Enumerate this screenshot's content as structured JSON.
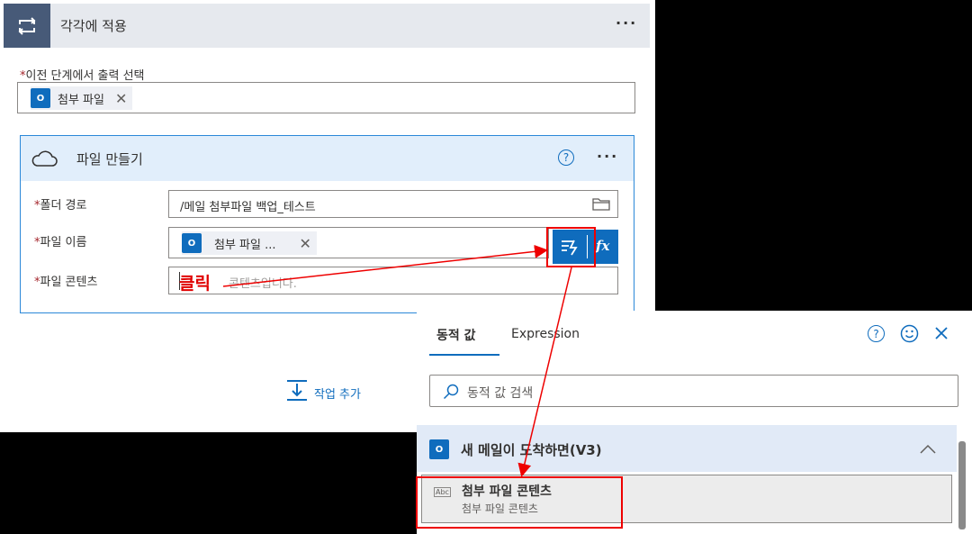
{
  "apply_each": {
    "title": "각각에 적용",
    "more": "···",
    "select_output_label": "이전 단계에서 출력 선택",
    "required_mark": "*",
    "token": "첨부 파일",
    "token_remove": "✕",
    "add_action": "작업 추가"
  },
  "create_file": {
    "title": "파일 만들기",
    "help": "?",
    "more": "···",
    "folder_label": "폴더 경로",
    "folder_value": "/메일 첨부파일 백업_테스트",
    "filename_label": "파일 이름",
    "filename_token": "첨부 파일 ...",
    "filename_token_remove": "✕",
    "content_label": "파일 콘텐츠",
    "content_placeholder": "콘텐츠입니다.",
    "fx": "fx"
  },
  "annotation": {
    "click_text": "클릭",
    "color": "#e00000"
  },
  "dynamic_panel": {
    "tabs": [
      {
        "label": "동적 값",
        "active": true
      },
      {
        "label": "Expression",
        "active": false
      }
    ],
    "search_placeholder": "동적 값 검색",
    "group_title": "새 메일이 도착하면(V3)",
    "item_title": "첨부 파일 콘텐츠",
    "item_subtitle": "첨부 파일 콘텐츠",
    "item_type_badge": "Abc"
  },
  "icons": {
    "outlook_badge": "O",
    "loop": "loop-icon",
    "cloud": "onedrive-cloud-icon",
    "folder": "folder-icon",
    "dynamic": "dynamic-content-icon",
    "search": "search-icon",
    "smiley": "smiley-icon",
    "close": "close-icon",
    "chevron_up": "chevron-up-icon",
    "add_action": "add-action-icon"
  },
  "colors": {
    "accent": "#0f6cbd",
    "header_dark": "#475a78",
    "highlight_red": "#e00000"
  }
}
